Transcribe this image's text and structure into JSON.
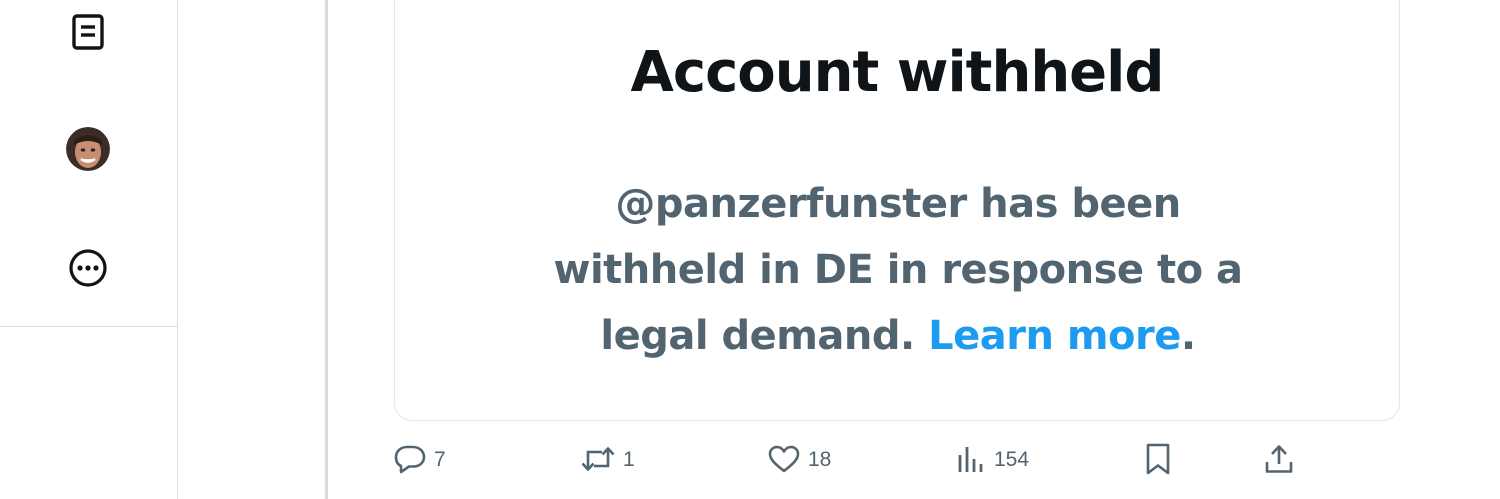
{
  "left_rail": {
    "items": [
      {
        "name": "lists",
        "icon": "lists-icon"
      },
      {
        "name": "profile",
        "icon": "avatar"
      },
      {
        "name": "more",
        "icon": "more-circle-icon"
      }
    ]
  },
  "card": {
    "title": "Account withheld",
    "body_text": "@panzerfunster has been withheld in DE in response to a legal demand.",
    "learn_more": "Learn more",
    "period": "."
  },
  "actions": {
    "reply_count": "7",
    "retweet_count": "1",
    "like_count": "18",
    "views_count": "154"
  },
  "colors": {
    "text_primary": "#0f1419",
    "text_secondary": "#536471",
    "link": "#1d9bf0",
    "border": "#e1e8ed"
  }
}
